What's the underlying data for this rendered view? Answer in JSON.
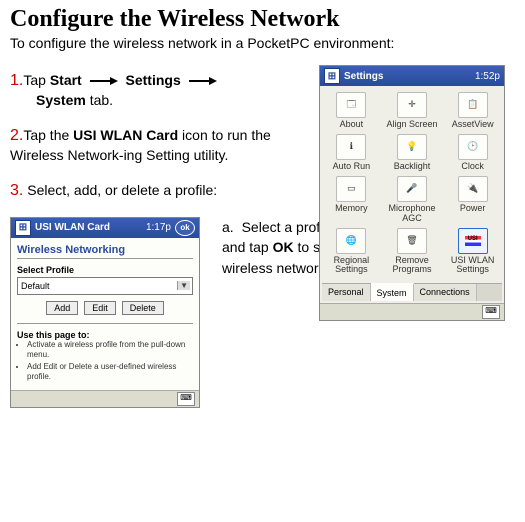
{
  "heading": "Configure the Wireless Network",
  "intro": "To configure the wireless network in a PocketPC environment:",
  "steps": {
    "s1": {
      "num": "1.",
      "pre": "Tap ",
      "b1": "Start",
      "mid": "",
      "b2": "Settings",
      "post": "",
      "line2_b": "System",
      "line2_t": " tab."
    },
    "s2": {
      "num": "2.",
      "pre": "Tap the ",
      "b": "USI WLAN Card",
      "post": " icon to run the Wireless Network-ing Setting utility."
    },
    "s3": {
      "num": "3.",
      "text": " Select, add, or delete a profile:"
    }
  },
  "settings_shot": {
    "title": "Settings",
    "time": "1:52p",
    "icons": [
      "About",
      "Align Screen",
      "AssetView",
      "Auto Run",
      "Backlight",
      "Clock",
      "Memory",
      "Microphone AGC",
      "Power",
      "Regional Settings",
      "Remove Programs",
      "USI WLAN Settings"
    ],
    "tabs": [
      "Personal",
      "System",
      "Connections"
    ]
  },
  "wlan_shot": {
    "title": "USI WLAN Card",
    "time": "1:17p",
    "ok": "ok",
    "section": "Wireless Networking",
    "select_label": "Select Profile",
    "select_value": "Default",
    "buttons": [
      "Add",
      "Edit",
      "Delete"
    ],
    "use_head": "Use this page to:",
    "use_items": [
      "Activate a wireless profile from the pull-down menu.",
      "Add Edit or Delete a user-defined wireless profile."
    ]
  },
  "sub_a": {
    "letter": "a. ",
    "t1": "Select a profile from the drop-down menu, and tap ",
    "b": "OK",
    "t2": " to switch your station from one wireless network to another."
  }
}
